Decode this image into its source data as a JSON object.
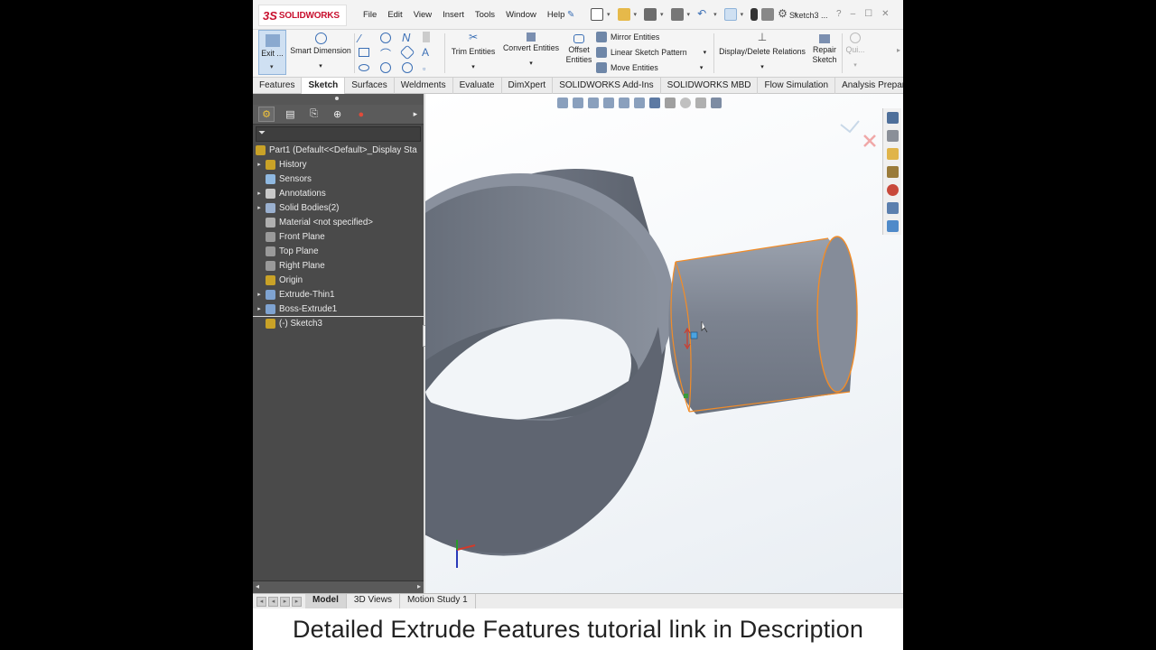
{
  "app": {
    "brand_ds": "3S",
    "brand_name": "SOLIDWORKS",
    "menu": [
      "File",
      "Edit",
      "View",
      "Insert",
      "Tools",
      "Window",
      "Help"
    ],
    "document_title": "Sketch3 ...",
    "help_glyph": "?"
  },
  "command_manager": {
    "exit_sketch": "Exit ...",
    "smart_dimension": "Smart Dimension",
    "trim_entities": "Trim Entities",
    "convert_entities": "Convert Entities",
    "offset_entities_1": "Offset",
    "offset_entities_2": "Entities",
    "mirror_entities": "Mirror Entities",
    "linear_sketch_pattern": "Linear Sketch Pattern",
    "move_entities": "Move Entities",
    "display_delete_relations": "Display/Delete Relations",
    "repair_sketch_1": "Repair",
    "repair_sketch_2": "Sketch",
    "quick_snaps": "Qui..."
  },
  "tabs": [
    "Features",
    "Sketch",
    "Surfaces",
    "Weldments",
    "Evaluate",
    "DimXpert",
    "SOLIDWORKS Add-Ins",
    "SOLIDWORKS MBD",
    "Flow Simulation",
    "Analysis Preparation"
  ],
  "active_tab": "Sketch",
  "feature_tree": {
    "root": "Part1  (Default<<Default>_Display Sta",
    "items": [
      {
        "label": "History",
        "expandable": true,
        "icon_color": "#c9a227"
      },
      {
        "label": "Sensors",
        "expandable": false,
        "icon_color": "#8fb8e0"
      },
      {
        "label": "Annotations",
        "expandable": true,
        "icon_color": "#c9c9c9"
      },
      {
        "label": "Solid Bodies(2)",
        "expandable": true,
        "icon_color": "#9ab0cf"
      },
      {
        "label": "Material <not specified>",
        "expandable": false,
        "icon_color": "#b0b0b0"
      },
      {
        "label": "Front Plane",
        "expandable": false,
        "icon_color": "#9a9a9a"
      },
      {
        "label": "Top Plane",
        "expandable": false,
        "icon_color": "#9a9a9a"
      },
      {
        "label": "Right Plane",
        "expandable": false,
        "icon_color": "#9a9a9a"
      },
      {
        "label": "Origin",
        "expandable": false,
        "icon_color": "#c9a227"
      },
      {
        "label": "Extrude-Thin1",
        "expandable": true,
        "icon_color": "#7fa3d1"
      },
      {
        "label": "Boss-Extrude1",
        "expandable": true,
        "icon_color": "#7fa3d1"
      },
      {
        "label": "(-) Sketch3",
        "expandable": false,
        "icon_color": "#c9a227"
      }
    ]
  },
  "bottom_tabs": [
    "Model",
    "3D Views",
    "Motion Study 1"
  ],
  "active_bottom_tab": "Model",
  "caption": "Detailed Extrude Features tutorial link in Description",
  "colors": {
    "sketch_edge": "#f28c28",
    "body_dark": "#5e6470",
    "body_mid": "#7d8491",
    "body_light": "#a8afbb"
  }
}
